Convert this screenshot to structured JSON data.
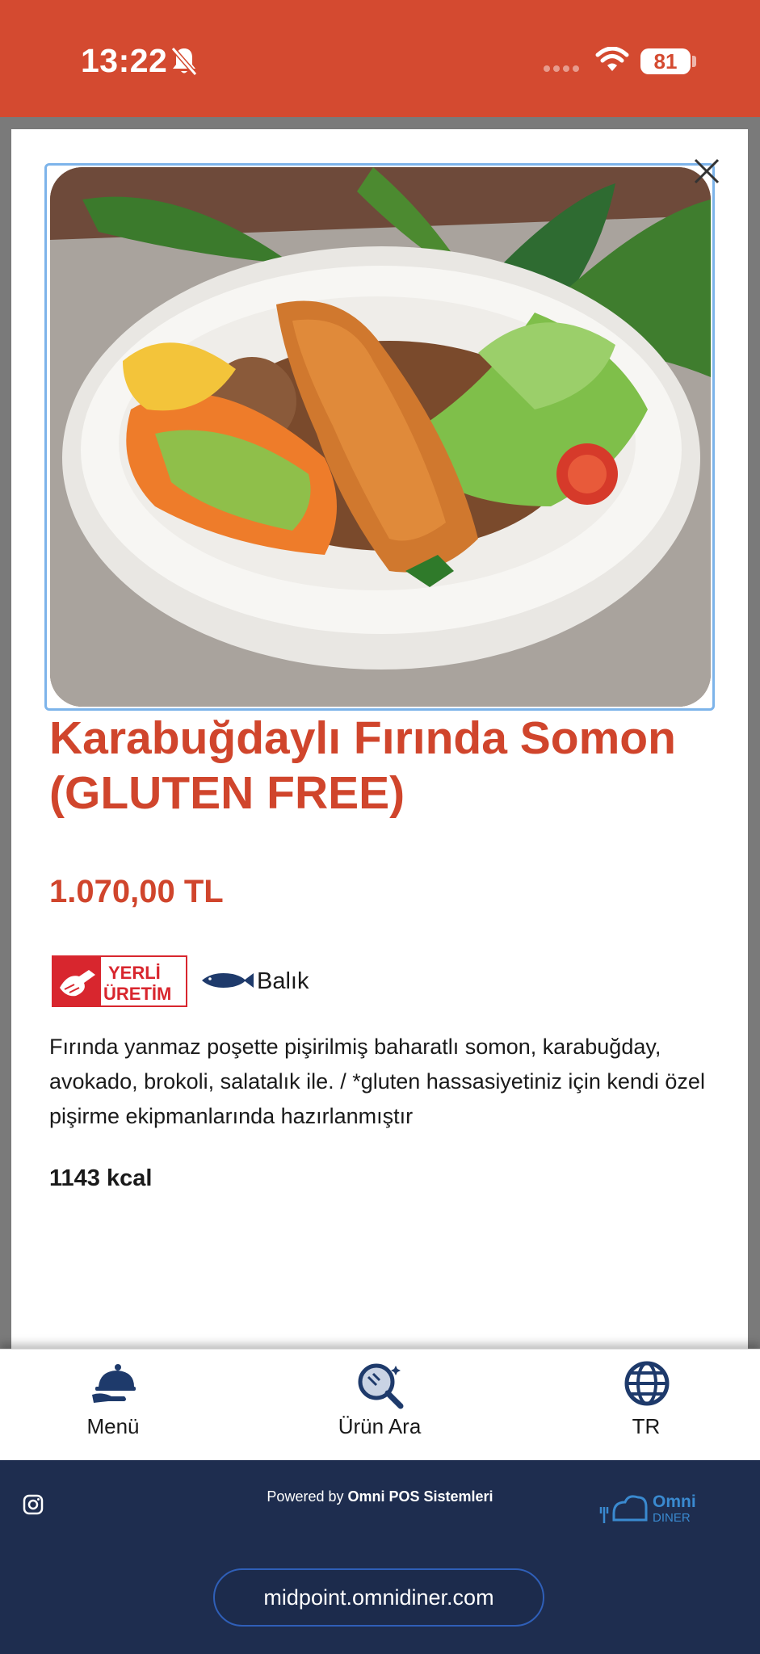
{
  "status_bar": {
    "time": "13:22",
    "battery": "81"
  },
  "product": {
    "title": "Karabuğdaylı Fırında Somon (GLUTEN FREE)",
    "price": "1.070,00 TL",
    "badge": {
      "line1": "YERLİ",
      "line2": "ÜRETİM"
    },
    "allergen_label": "Balık",
    "description": "Fırında yanmaz poşette pişirilmiş baharatlı somon, karabuğday, avokado, brokoli, salatalık ile. / *gluten hassasiyetiniz için kendi özel pişirme ekipmanlarında hazırlanmıştır",
    "calories": "1143 kcal"
  },
  "bottom_nav": {
    "menu_label": "Menü",
    "search_label": "Ürün Ara",
    "language_label": "TR"
  },
  "footer": {
    "powered_prefix": "Powered by",
    "powered_brand": "Omni POS Sistemleri",
    "logo_line1": "Omni",
    "logo_line2": "DINER",
    "url": "midpoint.omnidiner.com"
  },
  "colors": {
    "accent": "#d0452c",
    "status_bar": "#d44a30",
    "footer": "#1e2d4f"
  }
}
